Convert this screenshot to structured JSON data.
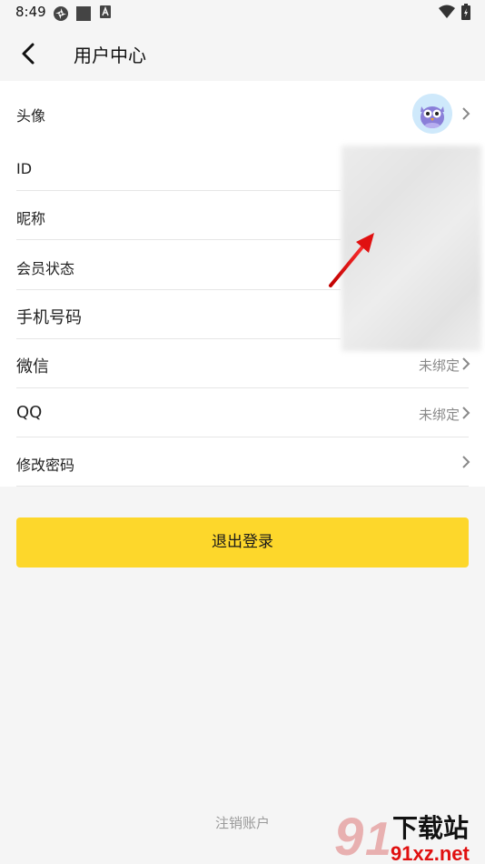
{
  "status_bar": {
    "time": "8:49",
    "icons": [
      "sync-icon",
      "square-app-icon",
      "a-badge-icon",
      "wifi-icon",
      "battery-icon"
    ]
  },
  "header": {
    "back_icon": "back-arrow-icon",
    "title": "用户中心"
  },
  "rows": {
    "avatar": {
      "label": "头像"
    },
    "id": {
      "label": "ID"
    },
    "nickname": {
      "label": "昵称"
    },
    "membership": {
      "label": "会员状态"
    },
    "phone": {
      "label": "手机号码"
    },
    "wechat": {
      "label": "微信",
      "value": "未绑定"
    },
    "qq": {
      "label": "QQ",
      "value": "未绑定"
    },
    "password": {
      "label": "修改密码"
    }
  },
  "logout_label": "退出登录",
  "cancel_account_label": "注销账户",
  "watermark": {
    "brand": "下载站",
    "domain": "91xz.net"
  },
  "colors": {
    "accent": "#fdd72b",
    "background": "#f5f5f5",
    "annotation_arrow": "#e01010"
  }
}
